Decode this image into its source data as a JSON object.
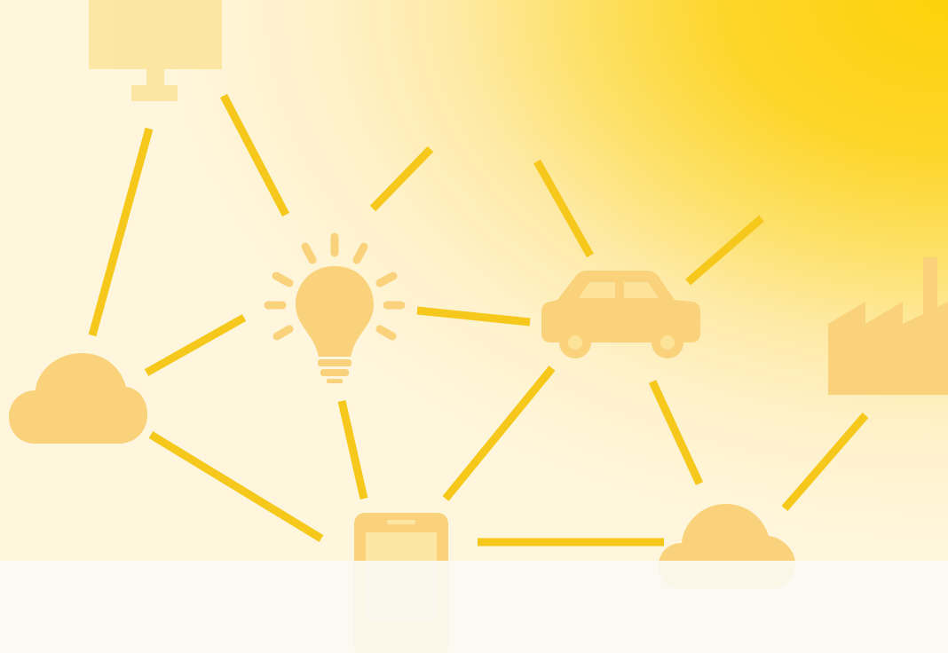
{
  "scene": {
    "caption": "",
    "icons": [
      "desktop-monitor-icon",
      "lightbulb-icon",
      "car-icon",
      "factory-icon",
      "cloud-icon",
      "smartphone-icon"
    ],
    "colors": {
      "background_start": "#fdd10a",
      "background_end": "#fff6dd",
      "network_line": "#f7c81c",
      "icon_fill": "#fbd27c",
      "band": "#faf9f4",
      "caption_text": "#2c2a6b"
    }
  }
}
